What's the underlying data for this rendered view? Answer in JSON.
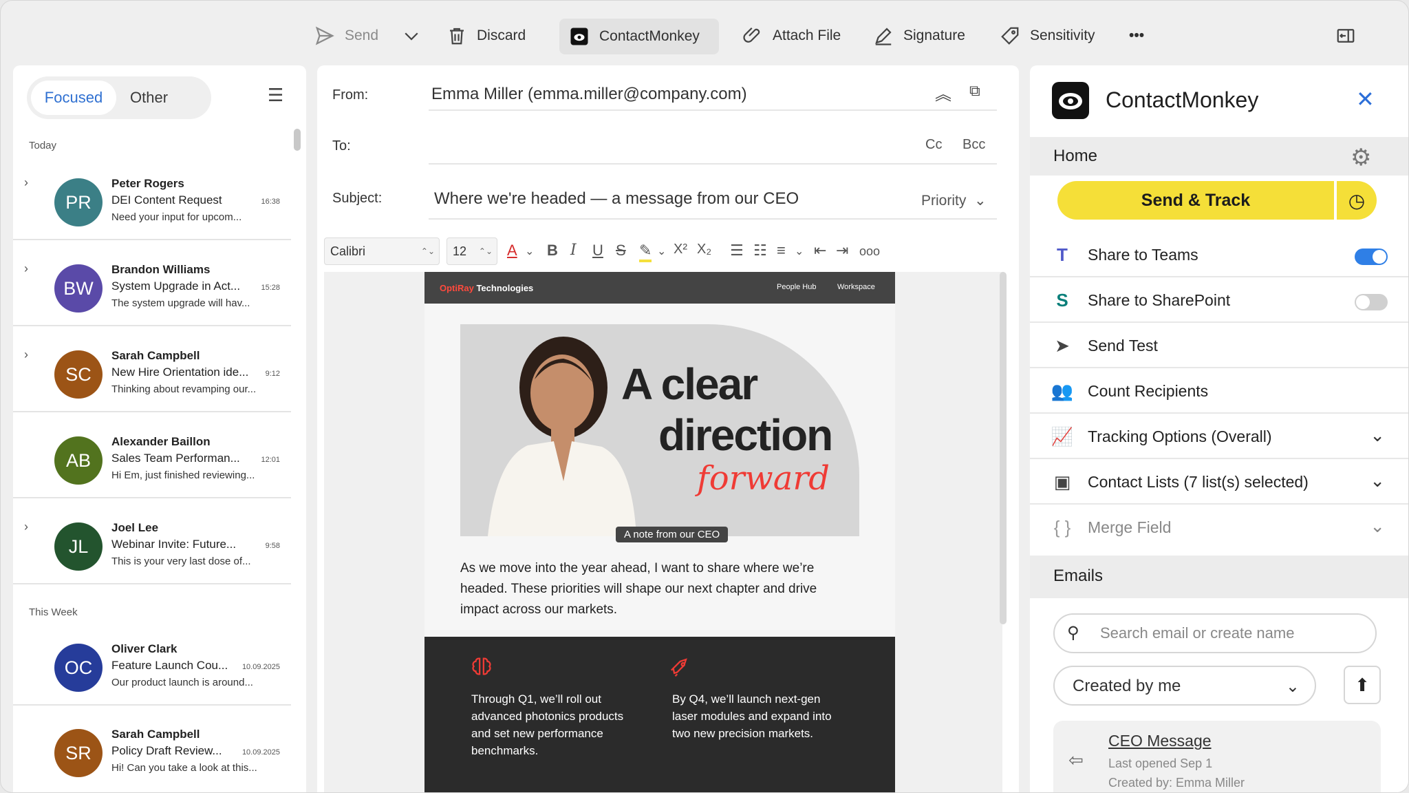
{
  "toolbar": {
    "send": "Send",
    "discard": "Discard",
    "contactmonkey": "ContactMonkey",
    "attach": "Attach File",
    "signature": "Signature",
    "sensitivity": "Sensitivity",
    "more": "•••"
  },
  "inbox": {
    "tabs": {
      "focused": "Focused",
      "other": "Other"
    },
    "groups": {
      "today": "Today",
      "this_week": "This Week"
    },
    "mails": [
      {
        "initials": "PR",
        "color": "#3b7f86",
        "name": "Peter Rogers",
        "subject": "DEI Content Request",
        "time": "16:38",
        "preview": "Need your input for upcom..."
      },
      {
        "initials": "BW",
        "color": "#5a4aa8",
        "name": "Brandon Williams",
        "subject": "System Upgrade in Act...",
        "time": "15:28",
        "preview": "The system upgrade will hav..."
      },
      {
        "initials": "SC",
        "color": "#9c5416",
        "name": "Sarah Campbell",
        "subject": "New Hire Orientation ide...",
        "time": "9:12",
        "preview": "Thinking about revamping our..."
      },
      {
        "initials": "AB",
        "color": "#52731e",
        "name": "Alexander Baillon",
        "subject": "Sales Team Performan...",
        "time": "12:01",
        "preview": "Hi Em, just finished reviewing..."
      },
      {
        "initials": "JL",
        "color": "#23542e",
        "name": "Joel Lee",
        "subject": "Webinar Invite: Future...",
        "time": "9:58",
        "preview": "This is your very last dose of..."
      },
      {
        "initials": "OC",
        "color": "#263c9a",
        "name": "Oliver Clark",
        "subject": "Feature Launch Cou...",
        "time": "10.09.2025",
        "preview": "Our product launch is around..."
      },
      {
        "initials": "SR",
        "color": "#9c5416",
        "name": "Sarah Campbell",
        "subject": "Policy Draft Review...",
        "time": "10.09.2025",
        "preview": "Hi! Can you take a look at this..."
      }
    ]
  },
  "compose": {
    "from_label": "From:",
    "from_value": "Emma Miller (emma.miller@company.com)",
    "to_label": "To:",
    "cc": "Cc",
    "bcc": "Bcc",
    "subject_label": "Subject:",
    "subject_value": "Where we're headed — a message from our CEO",
    "priority": "Priority",
    "font": "Calibri",
    "size": "12"
  },
  "email": {
    "logo_brand": "OptiRay",
    "logo_rest": " Technologies",
    "nav": [
      "People Hub",
      "Workspace"
    ],
    "hero_line1": "A clear",
    "hero_line2": "direction",
    "hero_line3": "forward",
    "badge": "A note from our CEO",
    "intro": "As we move into the year ahead, I want to share where we’re headed. These priorities will shape our next chapter and drive impact across our markets.",
    "col1": "Through Q1, we’ll roll out advanced photonics products and set new performance benchmarks.",
    "col2": "By Q4, we’ll launch next-gen laser modules and expand into two new precision markets."
  },
  "contactmonkey": {
    "title": "ContactMonkey",
    "home": "Home",
    "send_track": "Send & Track",
    "items": [
      {
        "label": "Share to Teams",
        "toggle": true
      },
      {
        "label": "Share to SharePoint",
        "toggle": false
      },
      {
        "label": "Send Test"
      },
      {
        "label": "Count Recipients"
      },
      {
        "label": "Tracking Options (Overall)"
      },
      {
        "label": "Contact Lists (7 list(s) selected)"
      },
      {
        "label": "Merge Field"
      }
    ],
    "emails": "Emails",
    "search_placeholder": "Search email or create name",
    "filter": "Created by me",
    "card": {
      "title": "CEO Message",
      "opened": "Last opened Sep 1",
      "creator": "Created by: Emma Miller"
    }
  },
  "colors": {
    "accent": "#2f70d1",
    "send_track": "#f5df38",
    "brand_red": "#ef3b35"
  }
}
